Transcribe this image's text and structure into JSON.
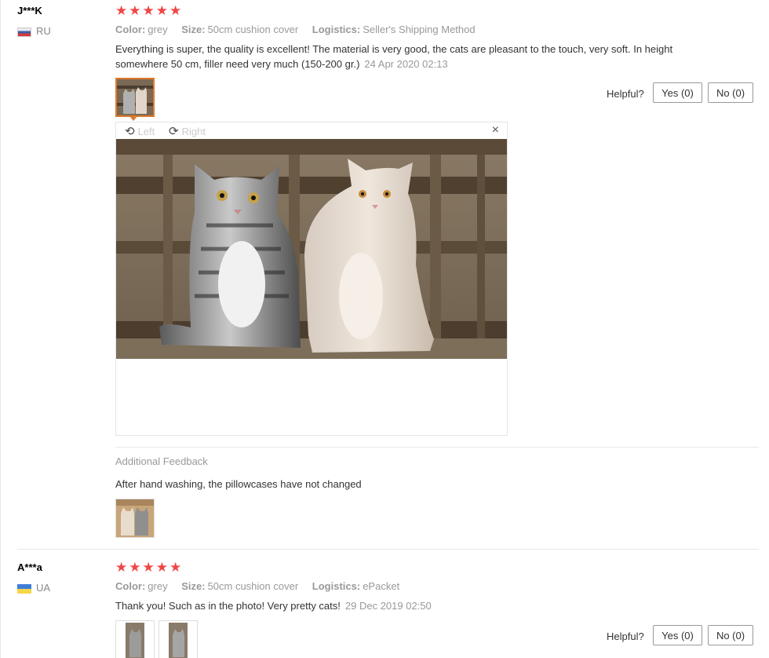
{
  "reviews": [
    {
      "user": "J***K",
      "country": "RU",
      "stars": "★★★★★",
      "attrs": {
        "color_label": "Color:",
        "color": "grey",
        "size_label": "Size:",
        "size": "50cm cushion cover",
        "logistics_label": "Logistics:",
        "logistics": "Seller's Shipping Method"
      },
      "text": "Everything is super, the quality is excellent! The material is very good, the cats are pleasant to the touch, very soft. In height somewhere 50 cm, filler need very much (150-200 gr.)",
      "date": "24 Apr 2020 02:13",
      "helpful_label": "Helpful?",
      "yes": "Yes (0)",
      "no": "No (0)",
      "viewer": {
        "left": "Left",
        "right": "Right",
        "close": "×"
      },
      "additional": {
        "title": "Additional Feedback",
        "text": "After hand washing, the pillowcases have not changed"
      }
    },
    {
      "user": "A***a",
      "country": "UA",
      "stars": "★★★★★",
      "attrs": {
        "color_label": "Color:",
        "color": "grey",
        "size_label": "Size:",
        "size": "50cm cushion cover",
        "logistics_label": "Logistics:",
        "logistics": "ePacket"
      },
      "text": "Thank you! Such as in the photo! Very pretty cats!",
      "date": "29 Dec 2019 02:50",
      "helpful_label": "Helpful?",
      "yes": "Yes (0)",
      "no": "No (0)"
    }
  ],
  "colors": {
    "star": "#f04646",
    "accent": "#e07a2c"
  }
}
